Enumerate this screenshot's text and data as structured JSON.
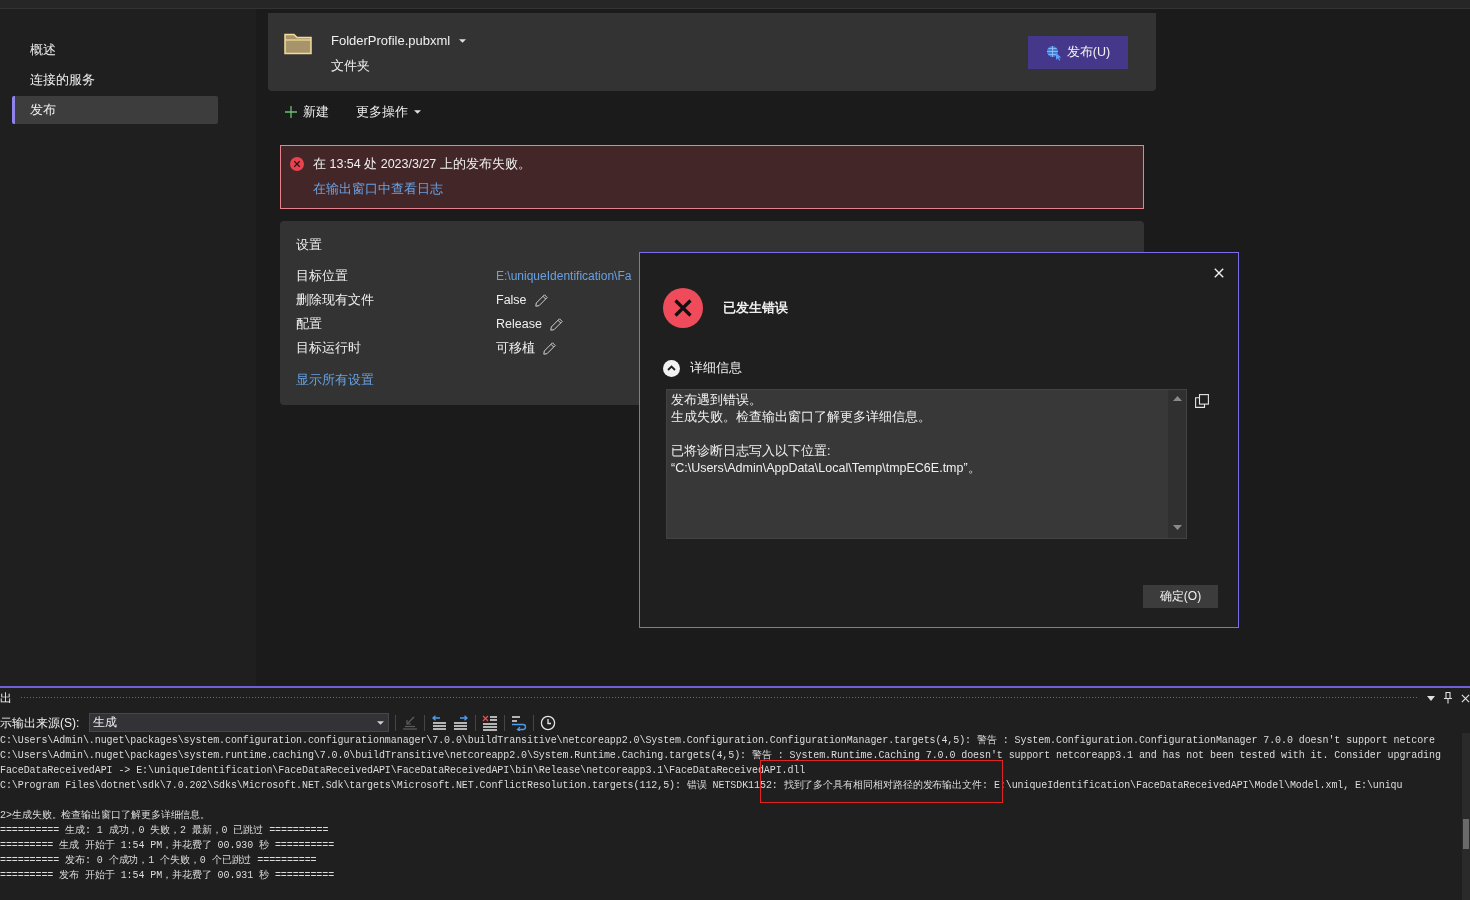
{
  "sidebar": {
    "items": [
      {
        "label": "概述",
        "selected": false
      },
      {
        "label": "连接的服务",
        "selected": false
      },
      {
        "label": "发布",
        "selected": true
      }
    ]
  },
  "profile": {
    "name": "FolderProfile.pubxml",
    "type": "文件夹",
    "publish_button": "发布(U)"
  },
  "actions": [
    {
      "kind": "add",
      "label": "新建"
    },
    {
      "kind": "menu",
      "label": "更多操作"
    }
  ],
  "error_banner": {
    "message": "在 13:54 处 2023/3/27 上的发布失败。",
    "link": "在输出窗口中查看日志"
  },
  "settings": {
    "title": "设置",
    "rows": [
      {
        "label": "目标位置",
        "value": "E:\\uniqueIdentification\\Fa",
        "kind": "link"
      },
      {
        "label": "删除现有文件",
        "value": "False",
        "kind": "editable"
      },
      {
        "label": "配置",
        "value": "Release",
        "kind": "editable"
      },
      {
        "label": "目标运行时",
        "value": "可移植",
        "kind": "editable"
      }
    ],
    "show_all_link": "显示所有设置"
  },
  "dialog": {
    "title": "已发生错误",
    "details_label": "详细信息",
    "expanded": true,
    "details_paragraphs": [
      [
        "发布遇到错误。",
        "生成失败。检查输出窗口了解更多详细信息。"
      ],
      [
        "已将诊断日志写入以下位置:",
        "“C:\\Users\\Admin\\AppData\\Local\\Temp\\tmpEC6E.tmp”。"
      ]
    ],
    "ok_button": "确定(O)"
  },
  "output": {
    "title": "出",
    "source_label": "示输出来源(S):",
    "source_value": "生成",
    "tools": [
      {
        "kind": "go_to_source",
        "disabled": true
      },
      {
        "kind": "previous",
        "disabled": false
      },
      {
        "kind": "next",
        "disabled": false
      },
      {
        "kind": "clear",
        "disabled": false
      },
      {
        "kind": "word_wrap",
        "disabled": false
      },
      {
        "kind": "timestamp",
        "disabled": false
      }
    ],
    "line_groups": [
      [
        "C:\\Users\\Admin\\.nuget\\packages\\system.configuration.configurationmanager\\7.0.0\\buildTransitive\\netcoreapp2.0\\System.Configuration.ConfigurationManager.targets(4,5): 警告 : System.Configuration.ConfigurationManager 7.0.0 doesn't support netcore",
        "C:\\Users\\Admin\\.nuget\\packages\\system.runtime.caching\\7.0.0\\buildTransitive\\netcoreapp2.0\\System.Runtime.Caching.targets(4,5): 警告 : System.Runtime.Caching 7.0.0 doesn't support netcoreapp3.1 and has not been tested with it. Consider upgrading",
        "FaceDataReceivedAPI -> E:\\uniqueIdentification\\FaceDataReceivedAPI\\FaceDataReceivedAPI\\bin\\Release\\netcoreapp3.1\\FaceDataReceivedAPI.dll",
        "C:\\Program Files\\dotnet\\sdk\\7.0.202\\Sdks\\Microsoft.NET.Sdk\\targets\\Microsoft.NET.ConflictResolution.targets(112,5): 错误 NETSDK1152: 找到了多个具有相同相对路径的发布输出文件: E:\\uniqueIdentification\\FaceDataReceivedAPI\\Model\\Model.xml, E:\\uniqu"
      ],
      [
        "2>生成失败。检查输出窗口了解更多详细信息。",
        "========== 生成: 1 成功，0 失败，2 最新，0 已跳过 ==========",
        "========= 生成 开始于 1:54 PM，并花费了 00.930 秒 ==========",
        "========== 发布: 0 个成功，1 个失败，0 个已跳过 ==========",
        "========= 发布 开始于 1:54 PM，并花费了 00.931 秒 =========="
      ]
    ]
  }
}
